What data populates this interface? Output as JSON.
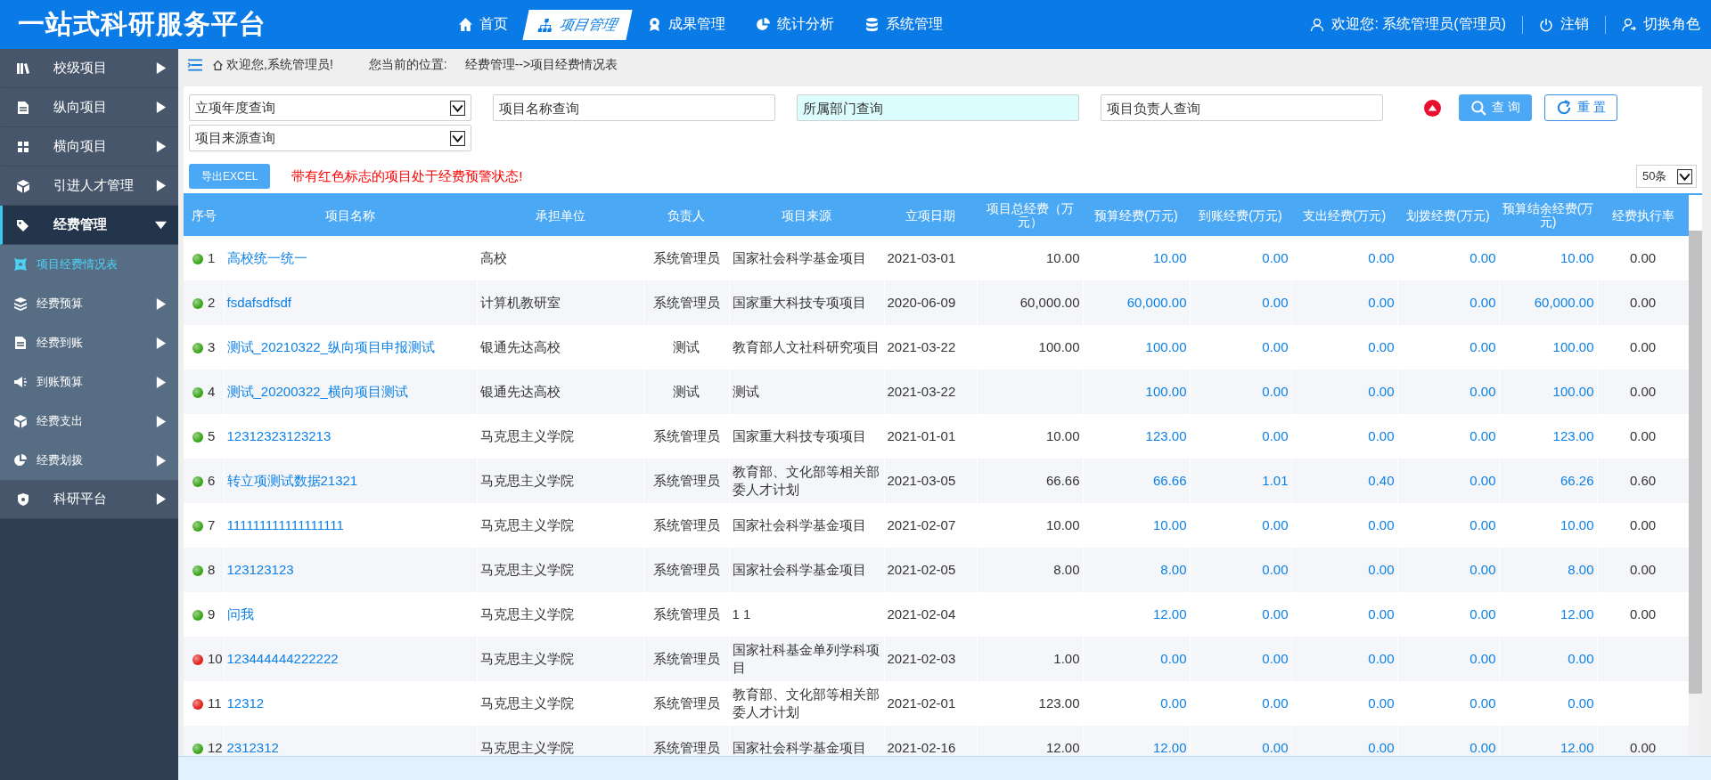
{
  "app_title": "一站式科研服务平台",
  "nav": [
    {
      "label": "首页",
      "selected": false
    },
    {
      "label": "项目管理",
      "selected": true
    },
    {
      "label": "成果管理",
      "selected": false
    },
    {
      "label": "统计分析",
      "selected": false
    },
    {
      "label": "系统管理",
      "selected": false
    }
  ],
  "user_menu": {
    "welcome": "欢迎您:  系统管理员(管理员)",
    "logout": "注销",
    "switch_role": "切换角色"
  },
  "sidebar": {
    "items": [
      {
        "label": "校级项目",
        "expanded": false,
        "selected": false
      },
      {
        "label": "纵向项目",
        "expanded": false,
        "selected": false
      },
      {
        "label": "横向项目",
        "expanded": false,
        "selected": false
      },
      {
        "label": "引进人才管理",
        "expanded": false,
        "selected": false
      },
      {
        "label": "经费管理",
        "expanded": true,
        "selected": true,
        "children": [
          {
            "label": "项目经费情况表",
            "selected": true,
            "has_children": false
          },
          {
            "label": "经费预算",
            "selected": false,
            "has_children": true
          },
          {
            "label": "经费到账",
            "selected": false,
            "has_children": true
          },
          {
            "label": "到账预算",
            "selected": false,
            "has_children": true
          },
          {
            "label": "经费支出",
            "selected": false,
            "has_children": true
          },
          {
            "label": "经费划拨",
            "selected": false,
            "has_children": true
          }
        ]
      },
      {
        "label": "科研平台",
        "expanded": false,
        "selected": false
      }
    ]
  },
  "breadcrumb": {
    "welcome": "欢迎您,系统管理员!",
    "location_label": "您当前的位置:",
    "path": "经费管理-->项目经费情况表"
  },
  "filters": [
    {
      "kind": "select",
      "value": "立项年度查询"
    },
    {
      "kind": "input",
      "placeholder": "项目名称查询",
      "focused": false
    },
    {
      "kind": "input",
      "placeholder": "所属部门查询",
      "focused": true
    },
    {
      "kind": "input",
      "placeholder": "项目负责人查询",
      "focused": false
    },
    {
      "kind": "select",
      "value": "项目来源查询"
    }
  ],
  "search_button": "查 询",
  "reset_button": "重 置",
  "export_button": "导出EXCEL",
  "warning": "带有红色标志的项目处于经费预警状态!",
  "page_size": "50条",
  "table": {
    "columns": [
      {
        "label": "序号",
        "kind": "index"
      },
      {
        "label": "项目名称",
        "kind": "link"
      },
      {
        "label": "承担单位",
        "kind": "text"
      },
      {
        "label": "负责人",
        "kind": "center"
      },
      {
        "label": "项目来源",
        "kind": "text"
      },
      {
        "label": "立项日期",
        "kind": "text"
      },
      {
        "label": "项目总经费（万元）",
        "kind": "number"
      },
      {
        "label": "预算经费(万元)",
        "kind": "amount"
      },
      {
        "label": "到账经费(万元)",
        "kind": "amount"
      },
      {
        "label": "支出经费(万元)",
        "kind": "amount"
      },
      {
        "label": "划拨经费(万元)",
        "kind": "amount"
      },
      {
        "label": "预算结余经费(万元)",
        "kind": "amount"
      },
      {
        "label": "经费执行率",
        "kind": "center"
      }
    ],
    "rows": [
      {
        "color": "#3aa519",
        "cells": [
          "1",
          "高校统一统一",
          "高校",
          "系统管理员",
          "国家社会科学基金项目",
          "2021-03-01",
          "10.00",
          "10.00",
          "0.00",
          "0.00",
          "0.00",
          "10.00",
          "0.00"
        ]
      },
      {
        "color": "#3aa519",
        "cells": [
          "2",
          "fsdafsdfsdf",
          "计算机教研室",
          "系统管理员",
          "国家重大科技专项项目",
          "2020-06-09",
          "60,000.00",
          "60,000.00",
          "0.00",
          "0.00",
          "0.00",
          "60,000.00",
          "0.00"
        ]
      },
      {
        "color": "#3aa519",
        "cells": [
          "3",
          "测试_20210322_纵向项目申报测试",
          "银通先达高校",
          "测试",
          "教育部人文社科研究项目",
          "2021-03-22",
          "100.00",
          "100.00",
          "0.00",
          "0.00",
          "0.00",
          "100.00",
          "0.00"
        ]
      },
      {
        "color": "#3aa519",
        "cells": [
          "4",
          "测试_20200322_横向项目测试",
          "银通先达高校",
          "测试",
          "测试",
          "2021-03-22",
          null,
          "100.00",
          "0.00",
          "0.00",
          "0.00",
          "100.00",
          "0.00"
        ]
      },
      {
        "color": "#3aa519",
        "cells": [
          "5",
          "12312323123213",
          "马克思主义学院",
          "系统管理员",
          "国家重大科技专项项目",
          "2021-01-01",
          "10.00",
          "123.00",
          "0.00",
          "0.00",
          "0.00",
          "123.00",
          "0.00"
        ]
      },
      {
        "color": "#3aa519",
        "cells": [
          "6",
          "转立项测试数据21321",
          "马克思主义学院",
          "系统管理员",
          "教育部、文化部等相关部委人才计划",
          "2021-03-05",
          "66.66",
          "66.66",
          "1.01",
          "0.40",
          "0.00",
          "66.26",
          "0.60"
        ]
      },
      {
        "color": "#3aa519",
        "cells": [
          "7",
          "111111111111111111",
          "马克思主义学院",
          "系统管理员",
          "国家社会科学基金项目",
          "2021-02-07",
          "10.00",
          "10.00",
          "0.00",
          "0.00",
          "0.00",
          "10.00",
          "0.00"
        ]
      },
      {
        "color": "#3aa519",
        "cells": [
          "8",
          "123123123",
          "马克思主义学院",
          "系统管理员",
          "国家社会科学基金项目",
          "2021-02-05",
          "8.00",
          "8.00",
          "0.00",
          "0.00",
          "0.00",
          "8.00",
          "0.00"
        ]
      },
      {
        "color": "#3aa519",
        "cells": [
          "9",
          "问我",
          "马克思主义学院",
          "系统管理员",
          "1 1",
          "2021-02-04",
          null,
          "12.00",
          "0.00",
          "0.00",
          "0.00",
          "12.00",
          "0.00"
        ]
      },
      {
        "color": "#e0201a",
        "cells": [
          "10",
          "123444444222222",
          "马克思主义学院",
          "系统管理员",
          "国家社科基金单列学科项目",
          "2021-02-03",
          "1.00",
          "0.00",
          "0.00",
          "0.00",
          "0.00",
          "0.00",
          null
        ]
      },
      {
        "color": "#e0201a",
        "cells": [
          "11",
          "12312",
          "马克思主义学院",
          "系统管理员",
          "教育部、文化部等相关部委人才计划",
          "2021-02-01",
          "123.00",
          "0.00",
          "0.00",
          "0.00",
          "0.00",
          "0.00",
          null
        ]
      },
      {
        "color": "#3aa519",
        "cells": [
          "12",
          "2312312",
          "马克思主义学院",
          "系统管理员",
          "国家社会科学基金项目",
          "2021-02-16",
          "12.00",
          "12.00",
          "0.00",
          "0.00",
          "0.00",
          "12.00",
          "0.00"
        ]
      }
    ]
  }
}
